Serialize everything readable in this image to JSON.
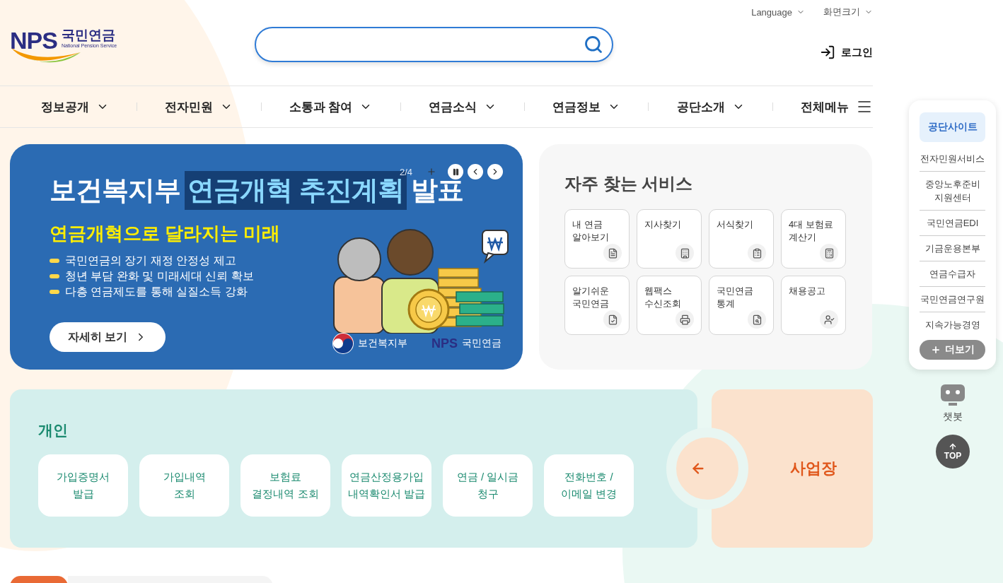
{
  "header": {
    "logo": {
      "mark": "NPS",
      "name": "국민연금",
      "subtitle": "National Pension Service"
    },
    "utility": [
      {
        "label": "Language"
      },
      {
        "label": "화면크기"
      }
    ],
    "login": "로그인"
  },
  "nav": {
    "items": [
      "정보공개",
      "전자민원",
      "소통과 참여",
      "연금소식",
      "연금정보",
      "공단소개"
    ],
    "all_menu": "전체메뉴"
  },
  "banner": {
    "title_before": "보건복지부",
    "title_highlight": "연금개혁 추진계획",
    "title_after": "발표",
    "subtitle": "연금개혁으로 달라지는 미래",
    "bullets": [
      "국민연금의 장기 재정 안정성 제고",
      "청년 부담 완화 및 미래세대 신뢰 확보",
      "다층 연금제도를 통해 실질소득 강화"
    ],
    "button": "자세히 보기",
    "counter": "2/4",
    "paused": false,
    "logos": [
      {
        "kind": "ministry",
        "label": "보건복지부"
      },
      {
        "kind": "nps",
        "mark": "NPS",
        "label": "국민연금"
      }
    ]
  },
  "services": {
    "title": "자주 찾는 서비스",
    "items": [
      {
        "label": "내 연금\n알아보기",
        "kind": "pension"
      },
      {
        "label": "지사찾기",
        "kind": "branch"
      },
      {
        "label": "서식찾기",
        "kind": "form"
      },
      {
        "label": "4대 보험료\n계산기",
        "kind": "calculator"
      },
      {
        "label": "알기쉬운\n국민연금",
        "kind": "guide"
      },
      {
        "label": "웹팩스\n수신조회",
        "kind": "fax"
      },
      {
        "label": "국민연금\n통계",
        "kind": "statistics"
      },
      {
        "label": "채용공고",
        "kind": "recruit"
      }
    ]
  },
  "personal": {
    "title": "개인",
    "buttons": [
      "가입증명서\n발급",
      "가입내역\n조회",
      "보험료\n결정내역 조회",
      "연금산정용가입\n내역확인서 발급",
      "연금 / 일시금\n청구",
      "전화번호 /\n이메일 변경"
    ]
  },
  "business": {
    "title": "사업장"
  },
  "quick_menu": {
    "title": "공단사이트",
    "items": [
      "전자민원서비스",
      "중앙노후준비\n지원센터",
      "국민연금EDI",
      "기금운용본부",
      "연금수급자",
      "국민연금연구원",
      "지속가능경영"
    ],
    "more": "더보기"
  },
  "chatbot": "챗봇",
  "top": "TOP"
}
